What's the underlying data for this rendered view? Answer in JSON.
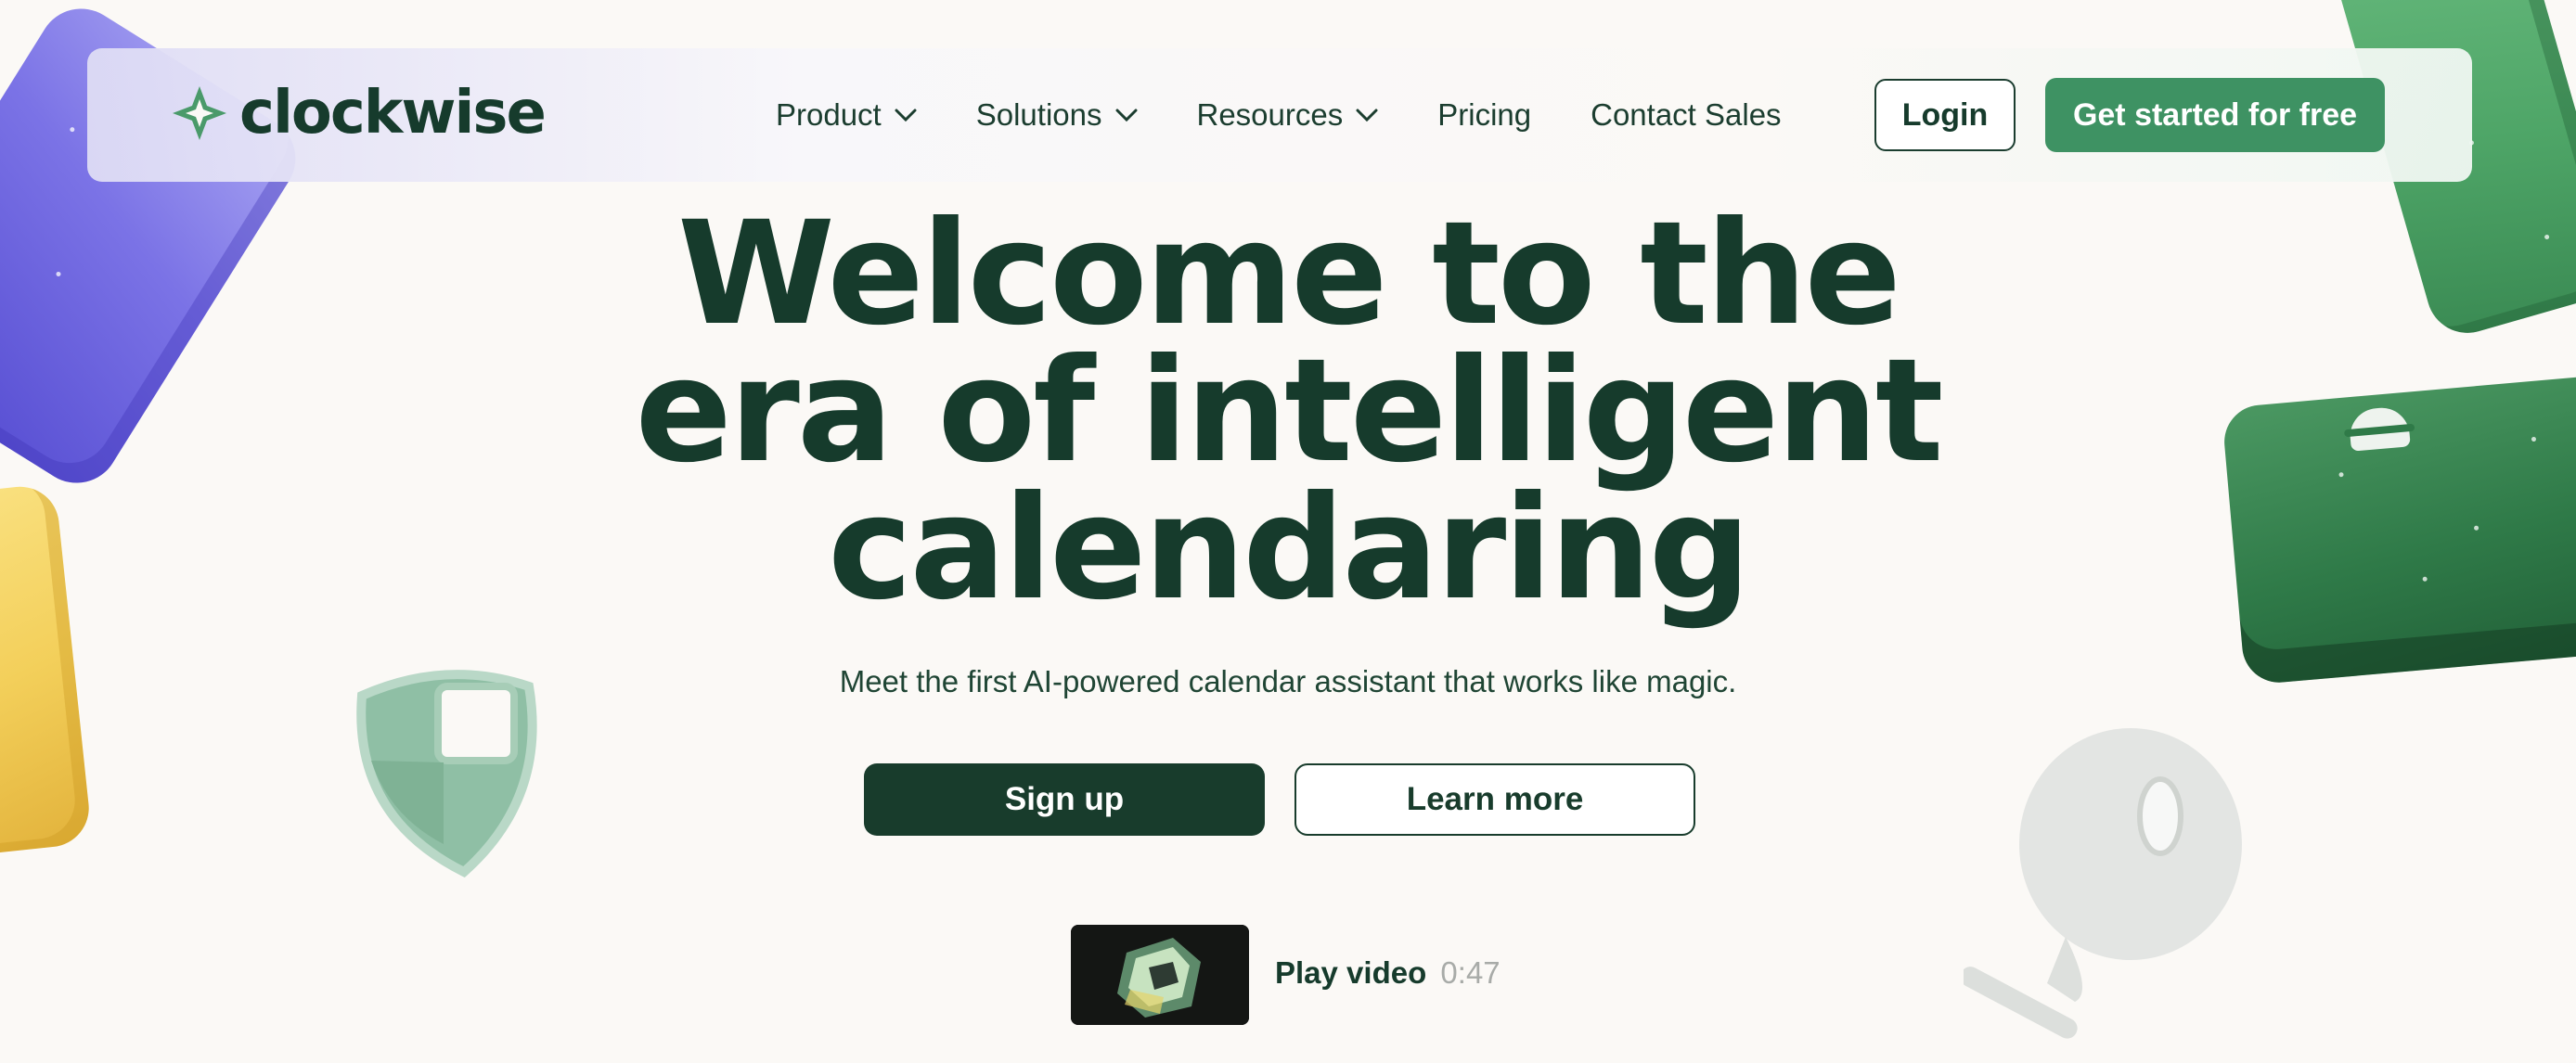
{
  "brand": {
    "name": "clockwise",
    "logo_icon": "clockwise-star-icon",
    "accent_color": "#3e9263",
    "dark_color": "#163b2c"
  },
  "nav": {
    "items": [
      {
        "label": "Product",
        "has_dropdown": true
      },
      {
        "label": "Solutions",
        "has_dropdown": true
      },
      {
        "label": "Resources",
        "has_dropdown": true
      },
      {
        "label": "Pricing",
        "has_dropdown": false
      },
      {
        "label": "Contact Sales",
        "has_dropdown": false
      }
    ],
    "login_label": "Login",
    "cta_label": "Get started for free"
  },
  "hero": {
    "title_lines": [
      "Welcome to the",
      "era of intelligent",
      "calendaring"
    ],
    "subtitle": "Meet the first AI-powered calendar assistant that works like magic.",
    "primary_button": "Sign up",
    "secondary_button": "Learn more"
  },
  "video": {
    "label": "Play video",
    "duration": "0:47"
  }
}
